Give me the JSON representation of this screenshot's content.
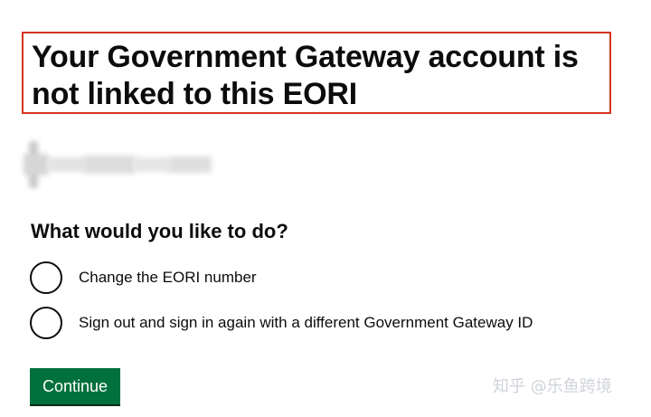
{
  "page": {
    "heading": "Your Government Gateway account is not linked to this EORI",
    "question": "What would you like to do?",
    "options": [
      {
        "label": "Change the EORI number",
        "selected": false
      },
      {
        "label": "Sign out and sign in again with a different Government Gateway ID",
        "selected": false
      }
    ],
    "continue_label": "Continue"
  },
  "watermark": "知乎 @乐鱼跨境",
  "colors": {
    "highlight_border": "#d4351c",
    "button": "#00703c",
    "text": "#0b0c0c"
  }
}
